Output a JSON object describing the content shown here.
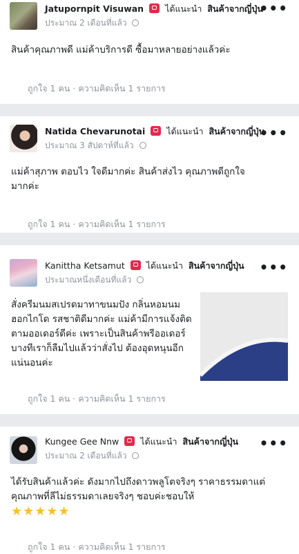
{
  "reviews": [
    {
      "author": "Jatupornpit Visuwan",
      "recommends_label": "ได้แนะนำ",
      "page_name": "สินค้าจากญี่ปุ่น",
      "time": "ประมาณ 2 เดือนที่แล้ว",
      "text": "สินค้าคุณภาพดี แม่ค้าบริการดี ซื้อมาหลายอย่างแล้วค่ะ",
      "likes": "ถูกใจ 1 คน",
      "comments": "ความคิดเห็น 1 รายการ"
    },
    {
      "author": "Natida Chevarunotai",
      "recommends_label": "ได้แนะนำ",
      "page_name": "สินค้าจากญี่ปุ่น",
      "time": "ประมาณ 3 สัปดาห์ที่แล้ว",
      "text": "แม่ค้าสุภาพ ตอบไว ใจดีมากค่ะ สินค้าส่งไว คุณภาพดีถูกใจมากค่ะ",
      "likes": "ถูกใจ 1 คน",
      "comments": "ความคิดเห็น 1 รายการ"
    },
    {
      "author": "Kanittha Ketsamut",
      "recommends_label": "ได้แนะนำ",
      "page_name": "สินค้าจากญี่ปุ่น",
      "time": "ประมาณหนึ่งเดือนที่แล้ว",
      "text": "สั่งครีมนมสเปรดมาทาขนมปัง กลิ่นหอมนมฮอกไกโด รสชาติดีมากค่ะ แม่ค้ามีการแจ้งติดตามออเดอร์ดีค่ะ เพราะเป็นสินค้าพรีออเดอร์ บางทีเราก็ลืมไปแล้วว่าสั่งไป ต้องอุดหนุนอีกแน่นอนค่ะ",
      "likes": "ถูกใจ 1 คน",
      "comments": "ความคิดเห็น 1 รายการ"
    },
    {
      "author": "Kungee Gee Nnw",
      "recommends_label": "ได้แนะนำ",
      "page_name": "สินค้าจากญี่ปุ่น",
      "time": "ประมาณ 2 เดือนที่แล้ว",
      "text": "ได้รับสินค้าแล้วค่ะ ดังมากไปถึงดาวพลูโตจริงๆ ราคาธรรมดาแต่คุณภาพที่ลีไม่ธรรมดาเลยจริงๆ ชอบค่ะชอบให้",
      "stars": "★★★★★",
      "likes": "ถูกใจ 1 คน",
      "comments": "ความคิดเห็น 1 รายการ"
    }
  ],
  "separator": "·",
  "colors": {
    "badge": "#e5284b",
    "meta": "#90949c",
    "stars": "#f6c12c",
    "divider": "#e9eaee"
  }
}
